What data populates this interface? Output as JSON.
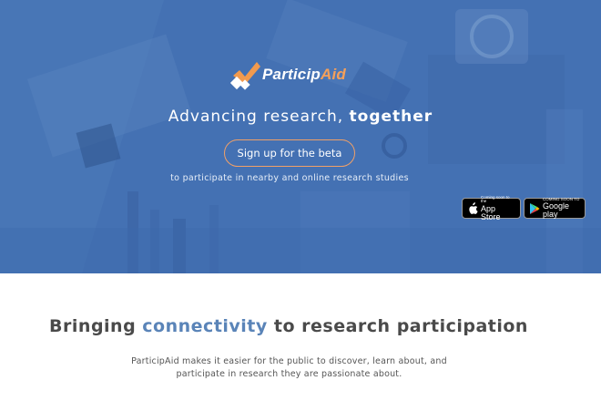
{
  "brand": {
    "name_part1": "Particip",
    "name_part2": "Aid",
    "colors": {
      "accent_orange": "#f29a4e",
      "hero_blue": "#4a76b5",
      "highlight_blue": "#5a84b8"
    }
  },
  "hero": {
    "tagline_prefix": "Advancing research, ",
    "tagline_strong": "together",
    "cta_label": "Sign up for the beta",
    "cta_subtext": "to participate in nearby and online research studies",
    "app_store": {
      "small": "Coming soon to the",
      "big": "App Store",
      "icon": "apple-icon"
    },
    "google_play": {
      "small": "COMING SOON TO",
      "big": "Google play",
      "icon": "play-icon"
    }
  },
  "intro": {
    "title_prefix": "Bringing ",
    "title_highlight": "connectivity",
    "title_suffix": " to research participation",
    "body": "ParticipAid makes it easier for the public to discover, learn about, and participate in research they are passionate about."
  }
}
